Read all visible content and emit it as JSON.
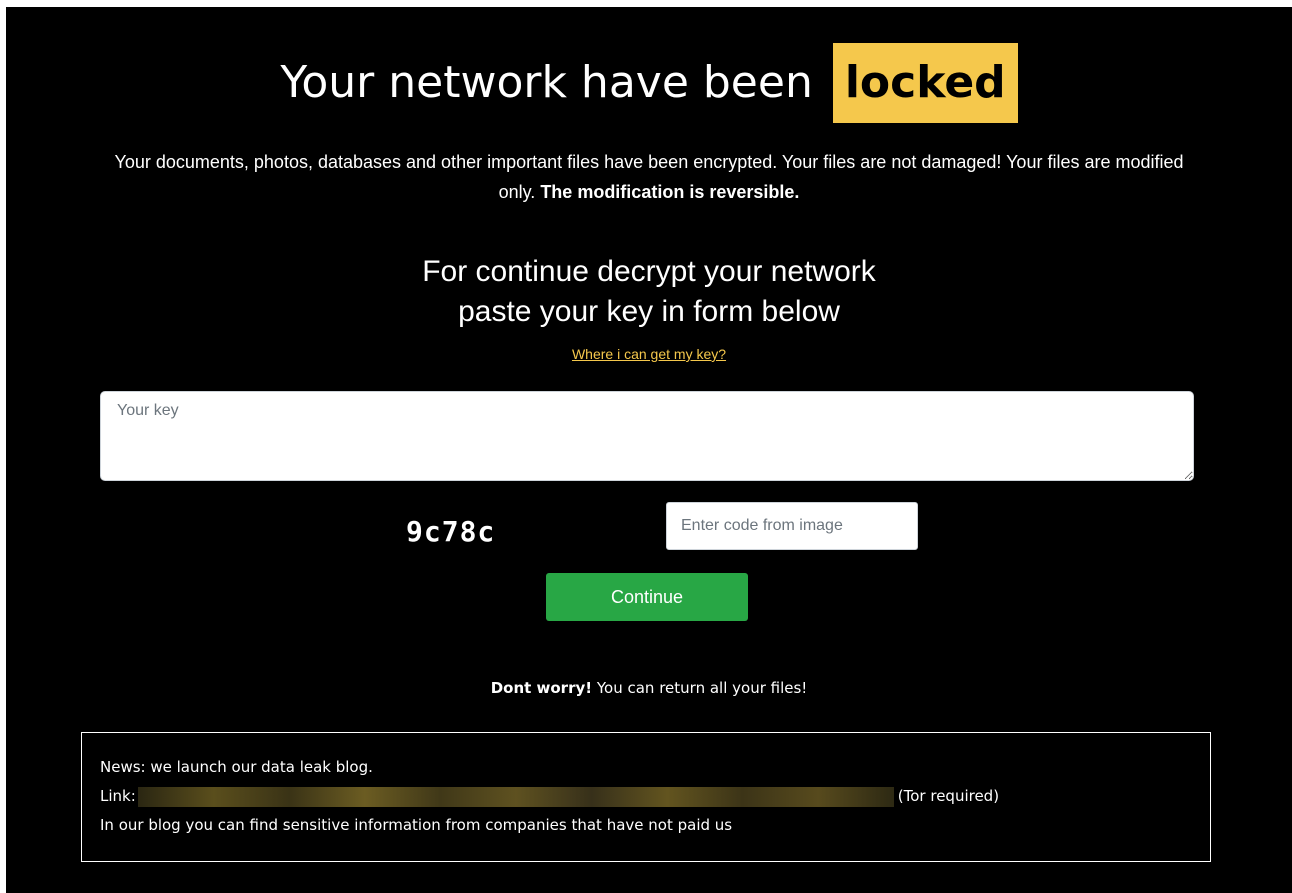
{
  "header": {
    "title_prefix": "Your network have been",
    "title_highlight": "locked"
  },
  "intro": {
    "text": "Your documents, photos, databases and other important files have been encrypted. Your files are not damaged! Your files are modified only.",
    "emphasis": "The modification is reversible."
  },
  "instructions": {
    "line1": "For continue decrypt your network",
    "line2": "paste your key in form below",
    "help_link": "Where i can get my key?"
  },
  "form": {
    "key_placeholder": "Your key",
    "captcha_text": "9c78c",
    "code_placeholder": "Enter code from image",
    "continue_label": "Continue"
  },
  "reassurance": {
    "bold": "Dont worry!",
    "text": "You can return all your files!"
  },
  "news": {
    "line1": "News: we launch our data leak blog.",
    "link_label": "Link:",
    "link_suffix": "(Tor required)",
    "line3": "In our blog you can find sensitive information from companies that have not paid us"
  },
  "colors": {
    "background": "#000000",
    "accent_yellow": "#f5c84c",
    "button_green": "#28a745"
  }
}
